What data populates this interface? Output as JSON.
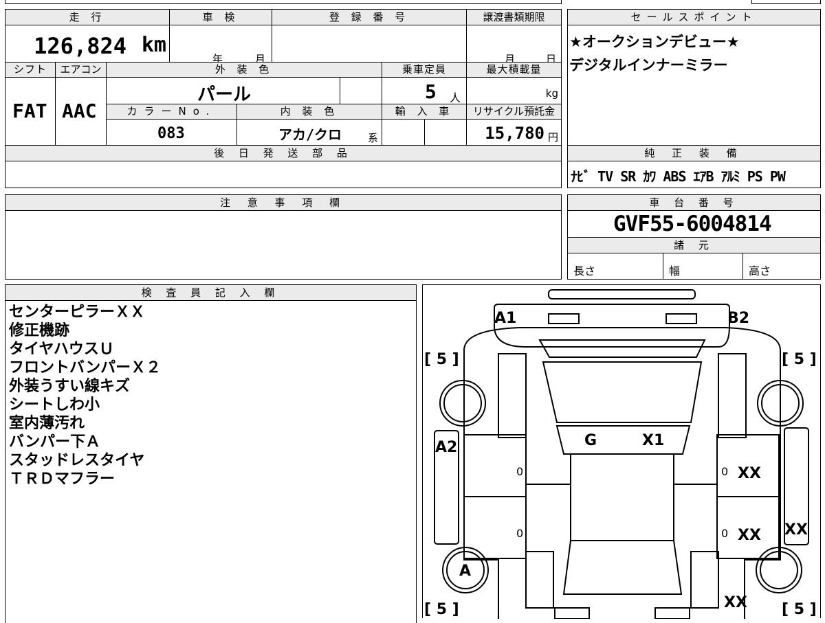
{
  "headers": {
    "mileage": "走 行",
    "inspection": "車 検",
    "registration": "登 録 番 号",
    "transfer_deadline": "譲渡書類期限",
    "sales_points": "セールスポイント",
    "shift": "シフト",
    "aircon": "エアコン",
    "exterior_color": "外 装 色",
    "capacity": "乗車定員",
    "max_load": "最大積載量",
    "color_no": "カラーNo.",
    "interior_color": "内 装 色",
    "import": "輸 入 車",
    "recycle": "リサイクル預託金",
    "later_parts": "後 日 発 送 部 品",
    "standard_equipment": "純 正 装 備",
    "notes": "注 意 事 項 欄",
    "chassis_no": "車 台 番 号",
    "specs": "諸 元",
    "inspector": "検 査 員 記 入 欄"
  },
  "values": {
    "mileage": "126,824",
    "mileage_unit": "km",
    "year_label": "年",
    "month_label": "月",
    "month_label2": "月",
    "day_label": "日",
    "shift": "FAT",
    "aircon": "AAC",
    "exterior_color": "パール",
    "capacity": "5",
    "capacity_unit": "人",
    "load_unit": "kg",
    "color_no": "083",
    "interior_color": "アカ/クロ",
    "interior_suffix": "系",
    "recycle": "15,780",
    "recycle_unit": "円",
    "chassis_no": "GVF55-6004814",
    "length_label": "長さ",
    "width_label": "幅",
    "height_label": "高さ"
  },
  "sales_points": [
    "★オークションデビュー★",
    "デジタルインナーミラー"
  ],
  "equipment": [
    "ﾅﾋﾞ",
    "TV",
    "SR",
    "ｶﾜ",
    "ABS",
    "ｴｱB",
    "ｱﾙﾐ",
    "PS",
    "PW"
  ],
  "inspector_notes": [
    "センターピラーＸＸ",
    "修正機跡",
    "タイヤハウスＵ",
    "フロントバンパーＸ２",
    "外装うすい線キズ",
    "シートしわ小",
    "室内薄汚れ",
    "バンパー下Ａ",
    "スタッドレスタイヤ",
    "ＴＲＤマフラー"
  ],
  "diagram_marks": {
    "a1": "A1",
    "b2": "B2",
    "g": "G",
    "x1": "X1",
    "a2": "A2",
    "xx_right_front": "XX",
    "xx_right_rear": "XX",
    "xx_side": "XX",
    "xx_bottom": "XX",
    "a_rear": "A",
    "zero1": "0",
    "zero2": "0",
    "zero3": "0",
    "zero4": "0",
    "tire_fl": "[ 5 ]",
    "tire_fr": "[ 5 ]",
    "tire_rl": "[ 5 ]",
    "tire_rr": "[ 5 ]"
  }
}
